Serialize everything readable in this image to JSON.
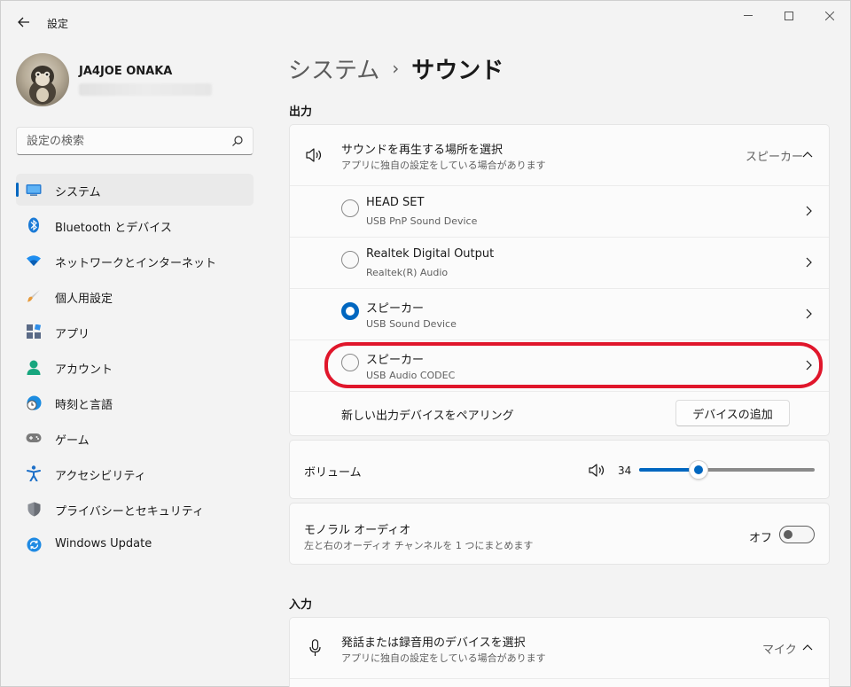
{
  "window": {
    "title": "設定",
    "controls": {
      "minimize": "minimize-icon",
      "maximize": "maximize-icon",
      "close": "close-icon"
    }
  },
  "profile": {
    "name": "JA4JOE ONAKA"
  },
  "search": {
    "placeholder": "設定の検索"
  },
  "sidebar": {
    "items": [
      {
        "label": "システム",
        "icon": "system-icon",
        "active": true
      },
      {
        "label": "Bluetooth とデバイス",
        "icon": "bluetooth-icon"
      },
      {
        "label": "ネットワークとインターネット",
        "icon": "wifi-icon"
      },
      {
        "label": "個人用設定",
        "icon": "brush-icon"
      },
      {
        "label": "アプリ",
        "icon": "apps-icon"
      },
      {
        "label": "アカウント",
        "icon": "account-icon"
      },
      {
        "label": "時刻と言語",
        "icon": "clock-globe-icon"
      },
      {
        "label": "ゲーム",
        "icon": "gamepad-icon"
      },
      {
        "label": "アクセシビリティ",
        "icon": "accessibility-icon"
      },
      {
        "label": "プライバシーとセキュリティ",
        "icon": "shield-icon"
      },
      {
        "label": "Windows Update",
        "icon": "update-icon"
      }
    ]
  },
  "breadcrumb": {
    "parent": "システム",
    "separator": "›",
    "current": "サウンド"
  },
  "output": {
    "section_label": "出力",
    "choose": {
      "title": "サウンドを再生する場所を選択",
      "subtitle": "アプリに独自の設定をしている場合があります",
      "value": "スピーカー"
    },
    "devices": [
      {
        "name": "HEAD SET",
        "detail": "USB PnP Sound Device",
        "selected": false
      },
      {
        "name": "Realtek Digital Output",
        "detail": "Realtek(R) Audio",
        "selected": false
      },
      {
        "name": "スピーカー",
        "detail": "USB Sound Device",
        "selected": true
      },
      {
        "name": "スピーカー",
        "detail": "USB Audio CODEC",
        "selected": false
      }
    ],
    "pair": {
      "label": "新しい出力デバイスをペアリング",
      "button": "デバイスの追加"
    },
    "volume": {
      "label": "ボリューム",
      "value": "34",
      "level": 34
    },
    "mono": {
      "title": "モノラル オーディオ",
      "subtitle": "左と右のオーディオ チャンネルを 1 つにまとめます",
      "state": "オフ"
    }
  },
  "input": {
    "section_label": "入力",
    "choose": {
      "title": "発話または録音用のデバイスを選択",
      "subtitle": "アプリに独自の設定をしている場合があります",
      "value": "マイク"
    }
  },
  "colors": {
    "accent": "#0067c0",
    "highlight": "#e0162b"
  }
}
